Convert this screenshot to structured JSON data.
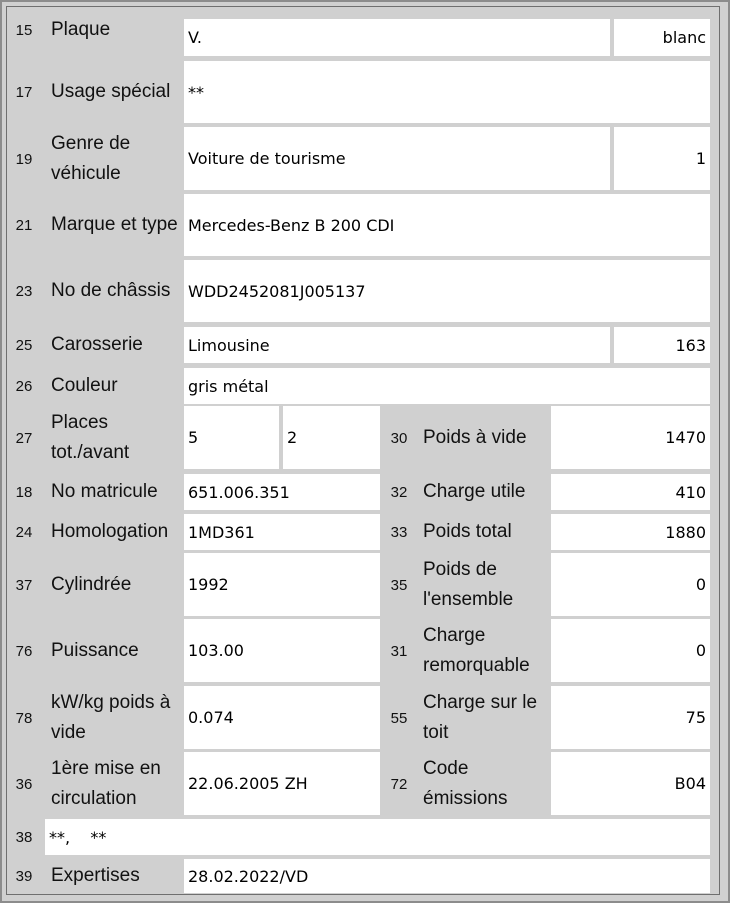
{
  "rows": {
    "r15": {
      "num": "15",
      "label": "Plaque",
      "value": "V.",
      "value2": "blanc"
    },
    "r17": {
      "num": "17",
      "label": "Usage spécial",
      "value": "**"
    },
    "r19": {
      "num": "19",
      "label": "Genre de véhicule",
      "value": "Voiture de tourisme",
      "value2": "1"
    },
    "r21": {
      "num": "21",
      "label": "Marque et type",
      "value": "Mercedes-Benz B 200 CDI"
    },
    "r23": {
      "num": "23",
      "label": "No de châssis",
      "value": "WDD2452081J005137"
    },
    "r25": {
      "num": "25",
      "label": "Carosserie",
      "value": "Limousine",
      "value2": "163"
    },
    "r26": {
      "num": "26",
      "label": "Couleur",
      "value": "gris métal"
    },
    "r27": {
      "num": "27",
      "label": "Places tot./avant",
      "value": "5",
      "value2": "2"
    },
    "r30": {
      "num": "30",
      "label": "Poids à vide",
      "value": "1470"
    },
    "r18": {
      "num": "18",
      "label": "No matricule",
      "value": "651.006.351"
    },
    "r32": {
      "num": "32",
      "label": "Charge utile",
      "value": "410"
    },
    "r24": {
      "num": "24",
      "label": "Homologation",
      "value": "1MD361"
    },
    "r33": {
      "num": "33",
      "label": "Poids total",
      "value": "1880"
    },
    "r37": {
      "num": "37",
      "label": "Cylindrée",
      "value": "1992"
    },
    "r35": {
      "num": "35",
      "label": "Poids de l'ensemble",
      "value": "0"
    },
    "r76": {
      "num": "76",
      "label": "Puissance",
      "value": "103.00"
    },
    "r31": {
      "num": "31",
      "label": "Charge remorquable",
      "value": "0"
    },
    "r78": {
      "num": "78",
      "label": "kW/kg poids à vide",
      "value": "0.074"
    },
    "r55": {
      "num": "55",
      "label": "Charge sur le toit",
      "value": "75"
    },
    "r36": {
      "num": "36",
      "label": "1ère mise en circulation",
      "value": "22.06.2005 ZH"
    },
    "r72": {
      "num": "72",
      "label": "Code émissions",
      "value": "B04"
    },
    "r38": {
      "num": "38",
      "value": "**,    **"
    },
    "r39": {
      "num": "39",
      "label": "Expertises",
      "value": "28.02.2022/VD"
    }
  }
}
